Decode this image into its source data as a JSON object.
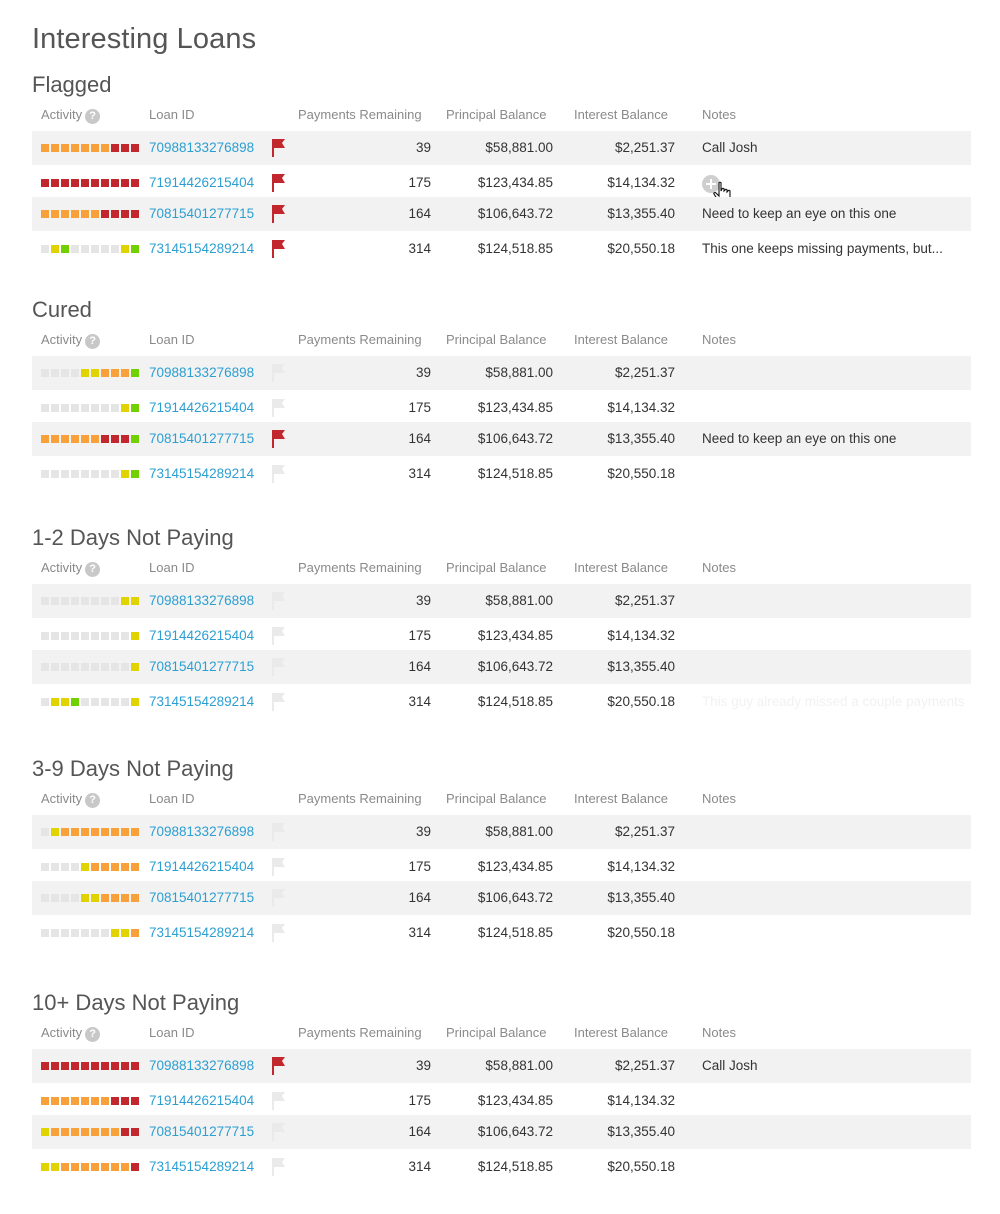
{
  "page_title": "Interesting Loans",
  "colors": {
    "gray": "#e5e5e5",
    "orange": "#f8a03a",
    "red": "#c1272d",
    "yellow": "#e0d300",
    "green": "#70d000",
    "link": "#2c9fd2",
    "flag_active": "#c1272d",
    "flag_inactive": "#eaeaea"
  },
  "columns": {
    "activity": "Activity",
    "activity_help_icon": "question-mark-icon",
    "loan_id": "Loan ID",
    "payments_remaining": "Payments Remaining",
    "principal_balance": "Principal Balance",
    "interest_balance": "Interest Balance",
    "notes": "Notes"
  },
  "sections": [
    {
      "title": "Flagged",
      "rows": [
        {
          "activity": [
            "orange",
            "orange",
            "orange",
            "orange",
            "orange",
            "orange",
            "orange",
            "red",
            "red",
            "red"
          ],
          "loan_id": "70988133276898",
          "flagged": true,
          "payments_remaining": "39",
          "principal_balance": "$58,881.00",
          "interest_balance": "$2,251.37",
          "notes": "Call Josh"
        },
        {
          "activity": [
            "red",
            "red",
            "red",
            "red",
            "red",
            "red",
            "red",
            "red",
            "red",
            "red"
          ],
          "loan_id": "71914426215404",
          "flagged": true,
          "payments_remaining": "175",
          "principal_balance": "$123,434.85",
          "interest_balance": "$14,134.32",
          "notes": "",
          "add_note_icon": "plus-circle-icon"
        },
        {
          "activity": [
            "orange",
            "orange",
            "orange",
            "orange",
            "orange",
            "orange",
            "red",
            "red",
            "red",
            "red"
          ],
          "loan_id": "70815401277715",
          "flagged": true,
          "payments_remaining": "164",
          "principal_balance": "$106,643.72",
          "interest_balance": "$13,355.40",
          "notes": "Need to keep an eye on this one"
        },
        {
          "activity": [
            "gray",
            "yellow",
            "green",
            "gray",
            "gray",
            "gray",
            "gray",
            "gray",
            "yellow",
            "green"
          ],
          "loan_id": "73145154289214",
          "flagged": true,
          "payments_remaining": "314",
          "principal_balance": "$124,518.85",
          "interest_balance": "$20,550.18",
          "notes": "This one keeps missing payments, but..."
        }
      ]
    },
    {
      "title": "Cured",
      "rows": [
        {
          "activity": [
            "gray",
            "gray",
            "gray",
            "gray",
            "yellow",
            "yellow",
            "orange",
            "orange",
            "orange",
            "green"
          ],
          "loan_id": "70988133276898",
          "flagged": false,
          "payments_remaining": "39",
          "principal_balance": "$58,881.00",
          "interest_balance": "$2,251.37",
          "notes": ""
        },
        {
          "activity": [
            "gray",
            "gray",
            "gray",
            "gray",
            "gray",
            "gray",
            "gray",
            "gray",
            "yellow",
            "green"
          ],
          "loan_id": "71914426215404",
          "flagged": false,
          "payments_remaining": "175",
          "principal_balance": "$123,434.85",
          "interest_balance": "$14,134.32",
          "notes": ""
        },
        {
          "activity": [
            "orange",
            "orange",
            "orange",
            "orange",
            "orange",
            "orange",
            "red",
            "red",
            "red",
            "green"
          ],
          "loan_id": "70815401277715",
          "flagged": true,
          "payments_remaining": "164",
          "principal_balance": "$106,643.72",
          "interest_balance": "$13,355.40",
          "notes": "Need to keep an eye on this one"
        },
        {
          "activity": [
            "gray",
            "gray",
            "gray",
            "gray",
            "gray",
            "gray",
            "gray",
            "gray",
            "yellow",
            "green"
          ],
          "loan_id": "73145154289214",
          "flagged": false,
          "payments_remaining": "314",
          "principal_balance": "$124,518.85",
          "interest_balance": "$20,550.18",
          "notes": ""
        }
      ]
    },
    {
      "title": "1-2 Days Not Paying",
      "rows": [
        {
          "activity": [
            "gray",
            "gray",
            "gray",
            "gray",
            "gray",
            "gray",
            "gray",
            "gray",
            "yellow",
            "yellow"
          ],
          "loan_id": "70988133276898",
          "flagged": false,
          "payments_remaining": "39",
          "principal_balance": "$58,881.00",
          "interest_balance": "$2,251.37",
          "notes": ""
        },
        {
          "activity": [
            "gray",
            "gray",
            "gray",
            "gray",
            "gray",
            "gray",
            "gray",
            "gray",
            "gray",
            "yellow"
          ],
          "loan_id": "71914426215404",
          "flagged": false,
          "payments_remaining": "175",
          "principal_balance": "$123,434.85",
          "interest_balance": "$14,134.32",
          "notes": ""
        },
        {
          "activity": [
            "gray",
            "gray",
            "gray",
            "gray",
            "gray",
            "gray",
            "gray",
            "gray",
            "gray",
            "yellow"
          ],
          "loan_id": "70815401277715",
          "flagged": false,
          "payments_remaining": "164",
          "principal_balance": "$106,643.72",
          "interest_balance": "$13,355.40",
          "notes": ""
        },
        {
          "activity": [
            "gray",
            "yellow",
            "yellow",
            "green",
            "gray",
            "gray",
            "gray",
            "gray",
            "gray",
            "yellow"
          ],
          "loan_id": "73145154289214",
          "flagged": false,
          "payments_remaining": "314",
          "principal_balance": "$124,518.85",
          "interest_balance": "$20,550.18",
          "notes": "This guy already missed a couple payments",
          "notes_faint": true
        }
      ]
    },
    {
      "title": "3-9 Days Not Paying",
      "rows": [
        {
          "activity": [
            "gray",
            "yellow",
            "orange",
            "orange",
            "orange",
            "orange",
            "orange",
            "orange",
            "orange",
            "orange"
          ],
          "loan_id": "70988133276898",
          "flagged": false,
          "payments_remaining": "39",
          "principal_balance": "$58,881.00",
          "interest_balance": "$2,251.37",
          "notes": ""
        },
        {
          "activity": [
            "gray",
            "gray",
            "gray",
            "gray",
            "yellow",
            "orange",
            "orange",
            "orange",
            "orange",
            "orange"
          ],
          "loan_id": "71914426215404",
          "flagged": false,
          "payments_remaining": "175",
          "principal_balance": "$123,434.85",
          "interest_balance": "$14,134.32",
          "notes": ""
        },
        {
          "activity": [
            "gray",
            "gray",
            "gray",
            "gray",
            "yellow",
            "yellow",
            "orange",
            "orange",
            "orange",
            "orange"
          ],
          "loan_id": "70815401277715",
          "flagged": false,
          "payments_remaining": "164",
          "principal_balance": "$106,643.72",
          "interest_balance": "$13,355.40",
          "notes": ""
        },
        {
          "activity": [
            "gray",
            "gray",
            "gray",
            "gray",
            "gray",
            "gray",
            "gray",
            "yellow",
            "yellow",
            "orange"
          ],
          "loan_id": "73145154289214",
          "flagged": false,
          "payments_remaining": "314",
          "principal_balance": "$124,518.85",
          "interest_balance": "$20,550.18",
          "notes": ""
        }
      ]
    },
    {
      "title": "10+ Days Not Paying",
      "rows": [
        {
          "activity": [
            "red",
            "red",
            "red",
            "red",
            "red",
            "red",
            "red",
            "red",
            "red",
            "red"
          ],
          "loan_id": "70988133276898",
          "flagged": true,
          "payments_remaining": "39",
          "principal_balance": "$58,881.00",
          "interest_balance": "$2,251.37",
          "notes": "Call Josh"
        },
        {
          "activity": [
            "orange",
            "orange",
            "orange",
            "orange",
            "orange",
            "orange",
            "orange",
            "red",
            "red",
            "red"
          ],
          "loan_id": "71914426215404",
          "flagged": false,
          "payments_remaining": "175",
          "principal_balance": "$123,434.85",
          "interest_balance": "$14,134.32",
          "notes": ""
        },
        {
          "activity": [
            "yellow",
            "orange",
            "orange",
            "orange",
            "orange",
            "orange",
            "orange",
            "orange",
            "red",
            "red"
          ],
          "loan_id": "70815401277715",
          "flagged": false,
          "payments_remaining": "164",
          "principal_balance": "$106,643.72",
          "interest_balance": "$13,355.40",
          "notes": ""
        },
        {
          "activity": [
            "yellow",
            "yellow",
            "orange",
            "orange",
            "orange",
            "orange",
            "orange",
            "orange",
            "orange",
            "red"
          ],
          "loan_id": "73145154289214",
          "flagged": false,
          "payments_remaining": "314",
          "principal_balance": "$124,518.85",
          "interest_balance": "$20,550.18",
          "notes": ""
        }
      ]
    }
  ]
}
